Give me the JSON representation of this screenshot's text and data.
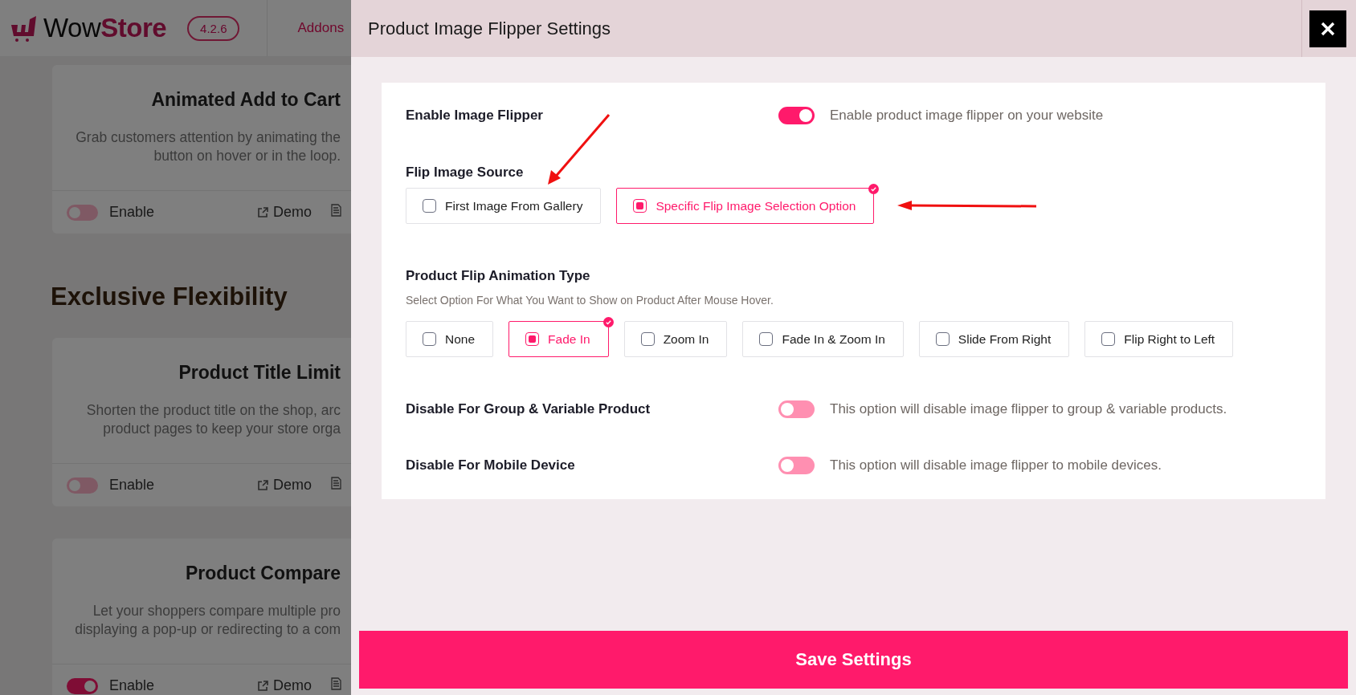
{
  "header": {
    "logo_prefix": "Wow",
    "logo_suffix": "Store",
    "version": "4.2.6",
    "nav": [
      "Addons"
    ]
  },
  "background_items": [
    {
      "kind": "card",
      "title": "Animated Add to Cart",
      "description": [
        "Grab customers attention by animating the",
        "button on hover or in the loop."
      ],
      "enabled": false,
      "toggle_label": "Enable",
      "demo_label": "Demo"
    },
    {
      "kind": "heading",
      "title": "Exclusive Flexibility"
    },
    {
      "kind": "card",
      "title": "Product Title Limit",
      "description": [
        "Shorten the product title on the shop, arc",
        "product pages to keep your store orga"
      ],
      "enabled": false,
      "toggle_label": "Enable",
      "demo_label": "Demo"
    },
    {
      "kind": "card",
      "title": "Product Compare",
      "description": [
        "Let your shoppers compare multiple pro",
        "displaying a pop-up or redirecting to a com"
      ],
      "enabled": true,
      "toggle_label": "Enable",
      "demo_label": "Demo"
    }
  ],
  "drawer": {
    "title": "Product Image Flipper Settings",
    "settings": [
      {
        "kind": "toggle",
        "label": "Enable Image Flipper",
        "on": true,
        "description": "Enable product image flipper on your website"
      },
      {
        "kind": "choice",
        "label": "Flip Image Source",
        "options": [
          {
            "label": "First Image From Gallery",
            "selected": false
          },
          {
            "label": "Specific Flip Image Selection Option",
            "selected": true
          }
        ]
      },
      {
        "kind": "choice",
        "label": "Product Flip Animation Type",
        "hint": "Select Option For What You Want to Show on Product After Mouse Hover.",
        "options": [
          {
            "label": "None",
            "selected": false
          },
          {
            "label": "Fade In",
            "selected": true
          },
          {
            "label": "Zoom In",
            "selected": false
          },
          {
            "label": "Fade In & Zoom In",
            "selected": false
          },
          {
            "label": "Slide From Right",
            "selected": false
          },
          {
            "label": "Flip Right to Left",
            "selected": false
          }
        ]
      },
      {
        "kind": "toggle",
        "label": "Disable For Group & Variable Product",
        "on": false,
        "description": "This option will disable image flipper to group & variable products."
      },
      {
        "kind": "toggle",
        "label": "Disable For Mobile Device",
        "on": false,
        "description": "This option will disable image flipper to mobile devices."
      }
    ],
    "save_button": "Save Settings"
  }
}
